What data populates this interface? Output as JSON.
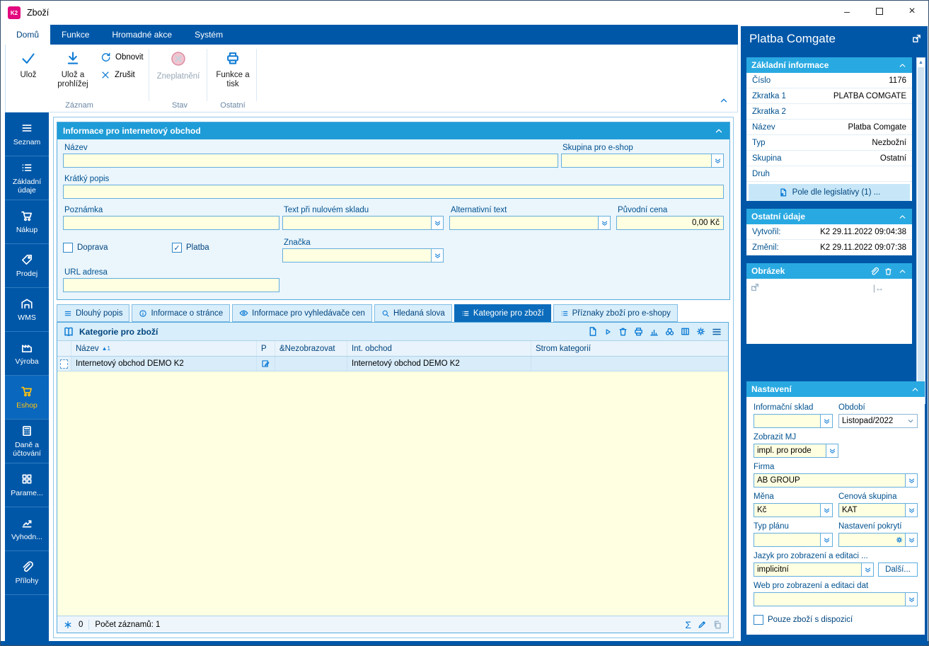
{
  "window": {
    "title": "Zboží",
    "app_icon": "K2"
  },
  "icons": {
    "check": "✓",
    "close": "×",
    "minimize": "–",
    "sum": "Σ",
    "sort_asc": "▲",
    "resize_handle": "|↔"
  },
  "ribbon": {
    "tabs": [
      {
        "label": "Domů",
        "active": true
      },
      {
        "label": "Funkce",
        "active": false
      },
      {
        "label": "Hromadné akce",
        "active": false
      },
      {
        "label": "Systém",
        "active": false
      }
    ],
    "save": "Ulož",
    "save_and_view": "Ulož a prohlížej",
    "refresh": "Obnovit",
    "cancel": "Zrušit",
    "invalidate": "Zneplatnění",
    "functions_print": "Funkce a tisk",
    "groups": [
      "Záznam",
      "Stav",
      "Ostatní"
    ]
  },
  "sidebar": {
    "items": [
      {
        "label": "Seznam",
        "active": false
      },
      {
        "label": "Základní údaje",
        "active": false
      },
      {
        "label": "Nákup",
        "active": false
      },
      {
        "label": "Prodej",
        "active": false
      },
      {
        "label": "WMS",
        "active": false
      },
      {
        "label": "Výroba",
        "active": false
      },
      {
        "label": "Eshop",
        "active": true
      },
      {
        "label": "Daně a účtování",
        "active": false
      },
      {
        "label": "Parame...",
        "active": false
      },
      {
        "label": "Vyhodn...",
        "active": false
      },
      {
        "label": "Přílohy",
        "active": false
      }
    ]
  },
  "eshop": {
    "title": "Informace pro internetový obchod",
    "nazev": {
      "label": "Název",
      "value": ""
    },
    "skupina": {
      "label": "Skupina pro e-shop",
      "value": ""
    },
    "kratky_popis": {
      "label": "Krátký popis",
      "value": ""
    },
    "poznamka": {
      "label": "Poznámka",
      "value": ""
    },
    "text_nulovy": {
      "label": "Text při nulovém skladu",
      "value": ""
    },
    "alt_text": {
      "label": "Alternativní text",
      "value": ""
    },
    "puvodni_cena": {
      "label": "Původní cena",
      "value": "0,00 Kč"
    },
    "doprava": {
      "label": "Doprava",
      "checked": false
    },
    "platba": {
      "label": "Platba",
      "checked": true
    },
    "znacka": {
      "label": "Značka",
      "value": ""
    },
    "url": {
      "label": "URL adresa",
      "value": ""
    }
  },
  "detail_tabs": [
    {
      "label": "Dlouhý popis",
      "active": false
    },
    {
      "label": "Informace o stránce",
      "active": false
    },
    {
      "label": "Informace pro vyhledávače cen",
      "active": false
    },
    {
      "label": "Hledaná slova",
      "active": false
    },
    {
      "label": "Kategorie pro zboží",
      "active": true
    },
    {
      "label": "Příznaky zboží pro e-shopy",
      "active": false
    }
  ],
  "categories": {
    "title": "Kategorie pro zboží",
    "columns": [
      "Název",
      "P",
      "&Nezobrazovat",
      "Int. obchod",
      "Strom kategorií"
    ],
    "sort_order": "1",
    "rows": [
      {
        "nazev": "Internetový obchod DEMO K2",
        "p": "",
        "nezobrazovat": "",
        "int_obchod": "Internetový obchod DEMO K2",
        "strom": ""
      }
    ],
    "status": {
      "counter": "0",
      "records": "Počet záznamů: 1"
    }
  },
  "right_panel": {
    "title": "Platba Comgate",
    "zakladni": {
      "title": "Základní informace",
      "rows": [
        {
          "label": "Číslo",
          "value": "1176"
        },
        {
          "label": "Zkratka 1",
          "value": "PLATBA COMGATE"
        },
        {
          "label": "Zkratka 2",
          "value": ""
        },
        {
          "label": "Název",
          "value": "Platba Comgate"
        },
        {
          "label": "Typ",
          "value": "Nezbožní"
        },
        {
          "label": "Skupina",
          "value": "Ostatní"
        },
        {
          "label": "Druh",
          "value": ""
        }
      ],
      "legislativa": "Pole dle legislativy (1) ..."
    },
    "ostatni": {
      "title": "Ostatní údaje",
      "rows": [
        {
          "label": "Vytvořil:",
          "value": "K2 29.11.2022 09:04:38"
        },
        {
          "label": "Změnil:",
          "value": "K2 29.11.2022 09:07:38"
        }
      ]
    },
    "obrazek": {
      "title": "Obrázek"
    },
    "nastaveni": {
      "title": "Nastavení",
      "informacni_sklad": {
        "label": "Informační sklad",
        "value": ""
      },
      "obdobi": {
        "label": "Období",
        "value": "Listopad/2022"
      },
      "zobrazit_mj": {
        "label": "Zobrazit MJ",
        "value": "impl. pro prode"
      },
      "firma": {
        "label": "Firma",
        "value": "AB GROUP"
      },
      "mena": {
        "label": "Měna",
        "value": "Kč"
      },
      "cenova_skupina": {
        "label": "Cenová skupina",
        "value": "KAT"
      },
      "typ_planu": {
        "label": "Typ plánu",
        "value": ""
      },
      "nastaveni_pokryti": {
        "label": "Nastavení pokrytí",
        "value": ""
      },
      "jazyk": {
        "label": "Jazyk pro zobrazení a editaci ...",
        "value": "implicitní"
      },
      "dalsi_button": "Další...",
      "web": {
        "label": "Web pro zobrazení a editaci dat",
        "value": ""
      },
      "pouze_zbozi": {
        "label": "Pouze zboží s dispozicí",
        "checked": false
      }
    }
  }
}
